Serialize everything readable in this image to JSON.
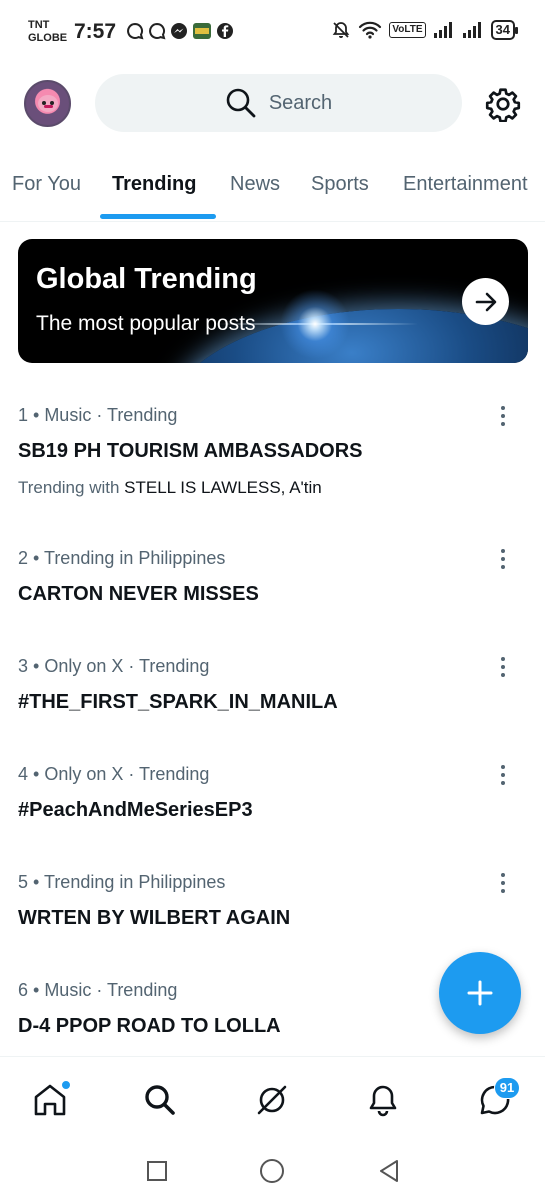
{
  "status_bar": {
    "carrier_line1": "TNT",
    "carrier_line2": "GLOBE",
    "time": "7:57",
    "network": "VoLTE",
    "battery": "34"
  },
  "header": {
    "search_placeholder": "Search",
    "avatar_icon": "profile-avatar",
    "settings_icon": "gear-icon"
  },
  "tabs": [
    {
      "label": "For You",
      "active": false
    },
    {
      "label": "Trending",
      "active": true
    },
    {
      "label": "News",
      "active": false
    },
    {
      "label": "Sports",
      "active": false
    },
    {
      "label": "Entertainment",
      "active": false
    }
  ],
  "banner": {
    "title": "Global Trending",
    "subtitle": "The most popular posts"
  },
  "trends": [
    {
      "meta": "1 • Music · Trending",
      "title": "SB19 PH TOURISM AMBASSADORS",
      "with_prefix": "Trending with",
      "with_items": "STELL IS LAWLESS, A'tin"
    },
    {
      "meta": "2 • Trending in Philippines",
      "title": "CARTON NEVER MISSES"
    },
    {
      "meta": "3 • Only on X · Trending",
      "title": "#THE_FIRST_SPARK_IN_MANILA"
    },
    {
      "meta": "4 • Only on X · Trending",
      "title": "#PeachAndMeSeriesEP3"
    },
    {
      "meta": "5 • Trending in Philippines",
      "title": "WRTEN BY WILBERT AGAIN"
    },
    {
      "meta": "6 • Music · Trending",
      "title": "D-4 PPOP ROAD TO LOLLA"
    }
  ],
  "bottom_nav": {
    "items": [
      "home-icon",
      "search-icon",
      "grok-icon",
      "bell-icon",
      "messages-icon"
    ],
    "messages_badge": "91"
  },
  "colors": {
    "accent": "#1d9bf0",
    "text_primary": "#0f1419",
    "text_secondary": "#536471"
  }
}
